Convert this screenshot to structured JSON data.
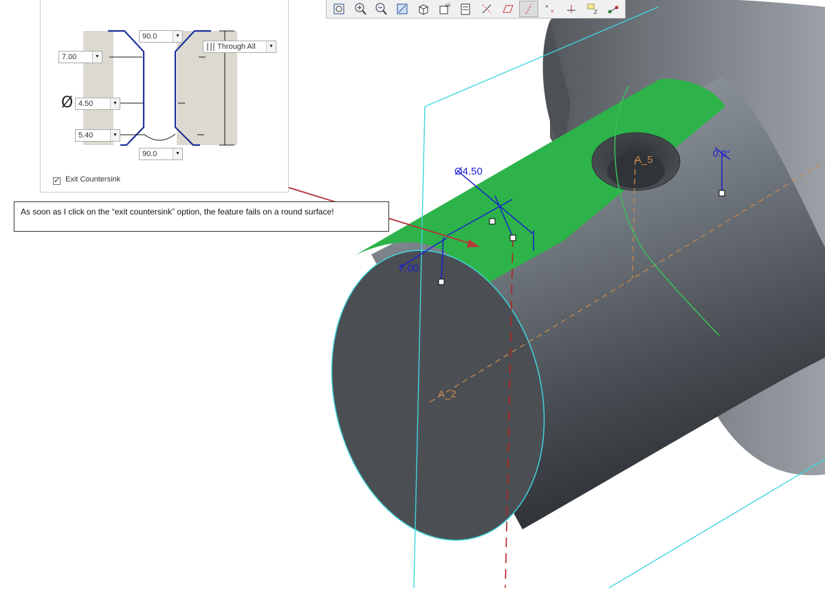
{
  "hole_dialog": {
    "top_angle": "90.0",
    "top_diameter": "7.00",
    "hole_diameter": "4.50",
    "bottom_diameter": "5.40",
    "bottom_angle": "90.0",
    "depth_option": "Through All",
    "diameter_symbol": "Ø",
    "exit_countersink_label": "Exit Countersink",
    "exit_countersink_checked": true,
    "check_mark": "✓",
    "dropdown_glyph": "▼"
  },
  "toolbar": {
    "buttons": [
      {
        "icon": "refit-icon"
      },
      {
        "icon": "zoom-in-icon"
      },
      {
        "icon": "zoom-out-icon"
      },
      {
        "icon": "repaint-icon"
      },
      {
        "icon": "display-style-icon"
      },
      {
        "icon": "saved-orientations-icon"
      },
      {
        "icon": "view-manager-icon"
      },
      {
        "icon": "datum-display-icon"
      },
      {
        "icon": "plane-display-icon"
      },
      {
        "icon": "axis-display-icon",
        "active": true
      },
      {
        "icon": "point-display-icon"
      },
      {
        "icon": "csys-display-icon"
      },
      {
        "icon": "annotation-display-icon"
      },
      {
        "icon": "spin-center-icon"
      }
    ]
  },
  "annotation": {
    "text": "As soon as I click on the “exit countersink” option,  the feature fails on a round surface!"
  },
  "model": {
    "dim_diameter": "Ø4.50",
    "dim_offset": "7.00",
    "dim_angle": "0.0°",
    "axis_a5": "A_5",
    "axis_a2": "A_2"
  },
  "colors": {
    "highlight_green": "#2db34a",
    "dimension_blue": "#1a1fcf",
    "datum_cyan": "#3fd6dd",
    "axis_orange": "#c98a4d",
    "arrow_red": "#b23a3a"
  }
}
